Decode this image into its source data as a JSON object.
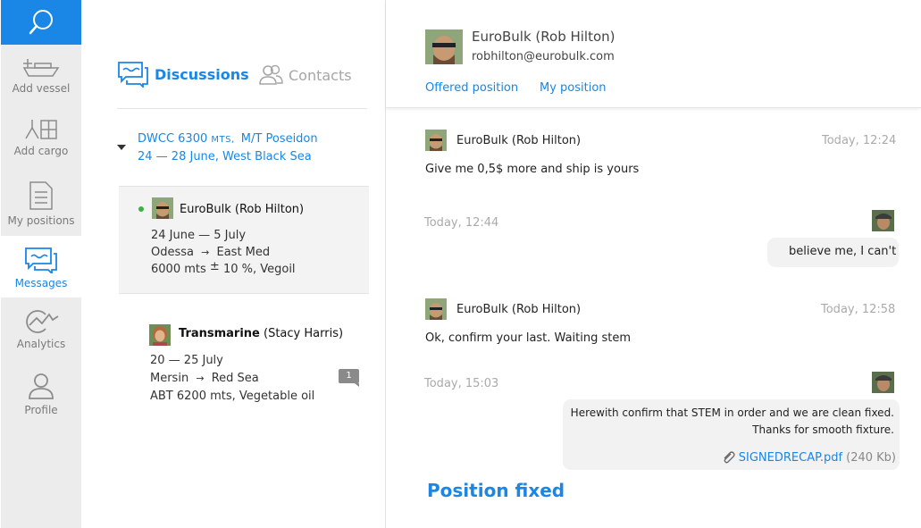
{
  "nav": {
    "items": [
      {
        "label": "Add vessel",
        "icon": "ship-icon"
      },
      {
        "label": "Add cargo",
        "icon": "cargo-icon"
      },
      {
        "label": "My positions",
        "icon": "document-icon"
      },
      {
        "label": "Messages",
        "icon": "chat-icon",
        "active": true
      },
      {
        "label": "Analytics",
        "icon": "analytics-icon"
      },
      {
        "label": "Profile",
        "icon": "user-icon"
      }
    ]
  },
  "tabs": {
    "discussions": "Discussions",
    "contacts": "Contacts"
  },
  "position": {
    "line1_a": "DWCC 6300",
    "line1_caps": "MTS,",
    "line1_b": "M/T Poseidon",
    "line2": "24 — 28 June, West Black Sea"
  },
  "conversations": [
    {
      "name": "EuroBulk (Rob Hilton)",
      "dates": "24 June — 5 July",
      "from": "Odessa",
      "to": "East Med",
      "cargo_a": "6000 mts",
      "cargo_pm": "±",
      "cargo_b": "10 %, Vegoil"
    },
    {
      "name_bold": "Transmarine",
      "name_rest": "(Stacy Harris)",
      "dates": "20 — 25 July",
      "from": "Mersin",
      "to": "Red Sea",
      "cargo": "ABT 6200 mts, Vegetable oil",
      "unread": "1"
    }
  ],
  "arrow": "→",
  "chat": {
    "contact_name": "EuroBulk (Rob Hilton)",
    "contact_email": "robhilton@eurobulk.com",
    "links": [
      "Offered position",
      "My position"
    ],
    "messages": [
      {
        "name": "EuroBulk (Rob Hilton)",
        "time": "Today, 12:24",
        "text": "Give me 0,5$ more and ship is yours"
      },
      {
        "time": "Today, 12:44",
        "text": "believe me, I can't"
      },
      {
        "name": "EuroBulk (Rob Hilton)",
        "time": "Today, 12:58",
        "text": "Ok, confirm your last. Waiting stem"
      },
      {
        "time": "Today, 15:03",
        "text_1": "Herewith confirm that STEM in order and we are clean fixed.",
        "text_2": "Thanks for smooth fixture.",
        "attachment": "SIGNEDRECAP.pdf",
        "attachment_size": "(240 Kb)"
      }
    ],
    "status": "Position fixed"
  },
  "colors": {
    "accent": "#1a86e5",
    "online": "#3cb043",
    "nav_bg": "#ececec"
  }
}
